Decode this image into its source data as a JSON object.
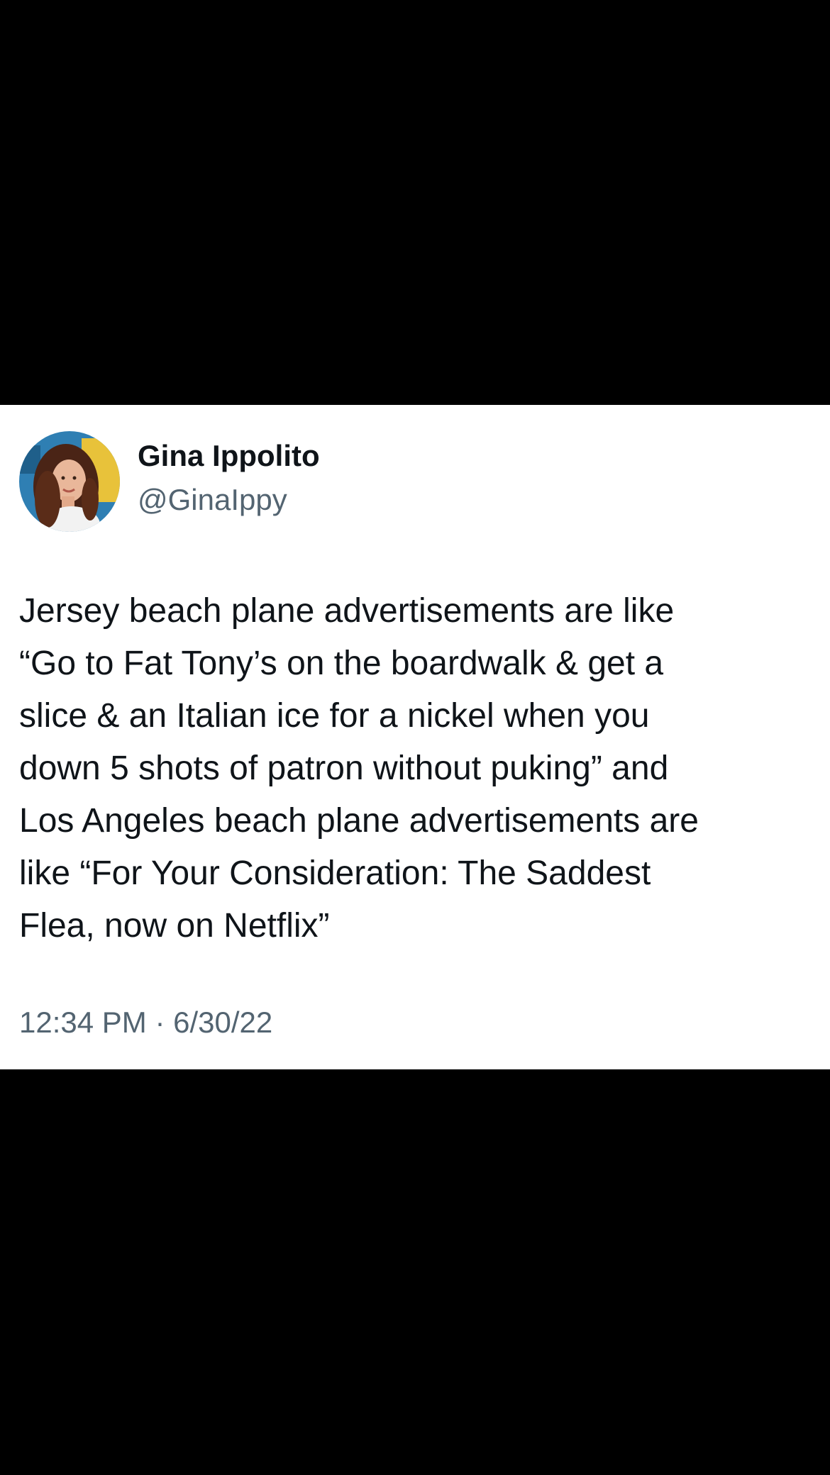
{
  "tweet": {
    "author": {
      "name": "Gina Ippolito",
      "handle": "@GinaIppy"
    },
    "text_lines": [
      "Jersey beach plane advertisements are like",
      "“Go to Fat Tony’s on the boardwalk & get a",
      "slice & an Italian ice for a nickel when you",
      "down 5 shots of patron without puking” and",
      "Los Angeles beach plane advertisements are",
      "like “For Your Consideration: The Saddest",
      "Flea, now on Netflix”"
    ],
    "time": "12:34 PM",
    "separator": "·",
    "date": "6/30/22"
  },
  "colors": {
    "background": "#000000",
    "card": "#ffffff",
    "primary_text": "#0f1419",
    "secondary_text": "#536471"
  },
  "icons": {
    "avatar": "profile-photo"
  }
}
